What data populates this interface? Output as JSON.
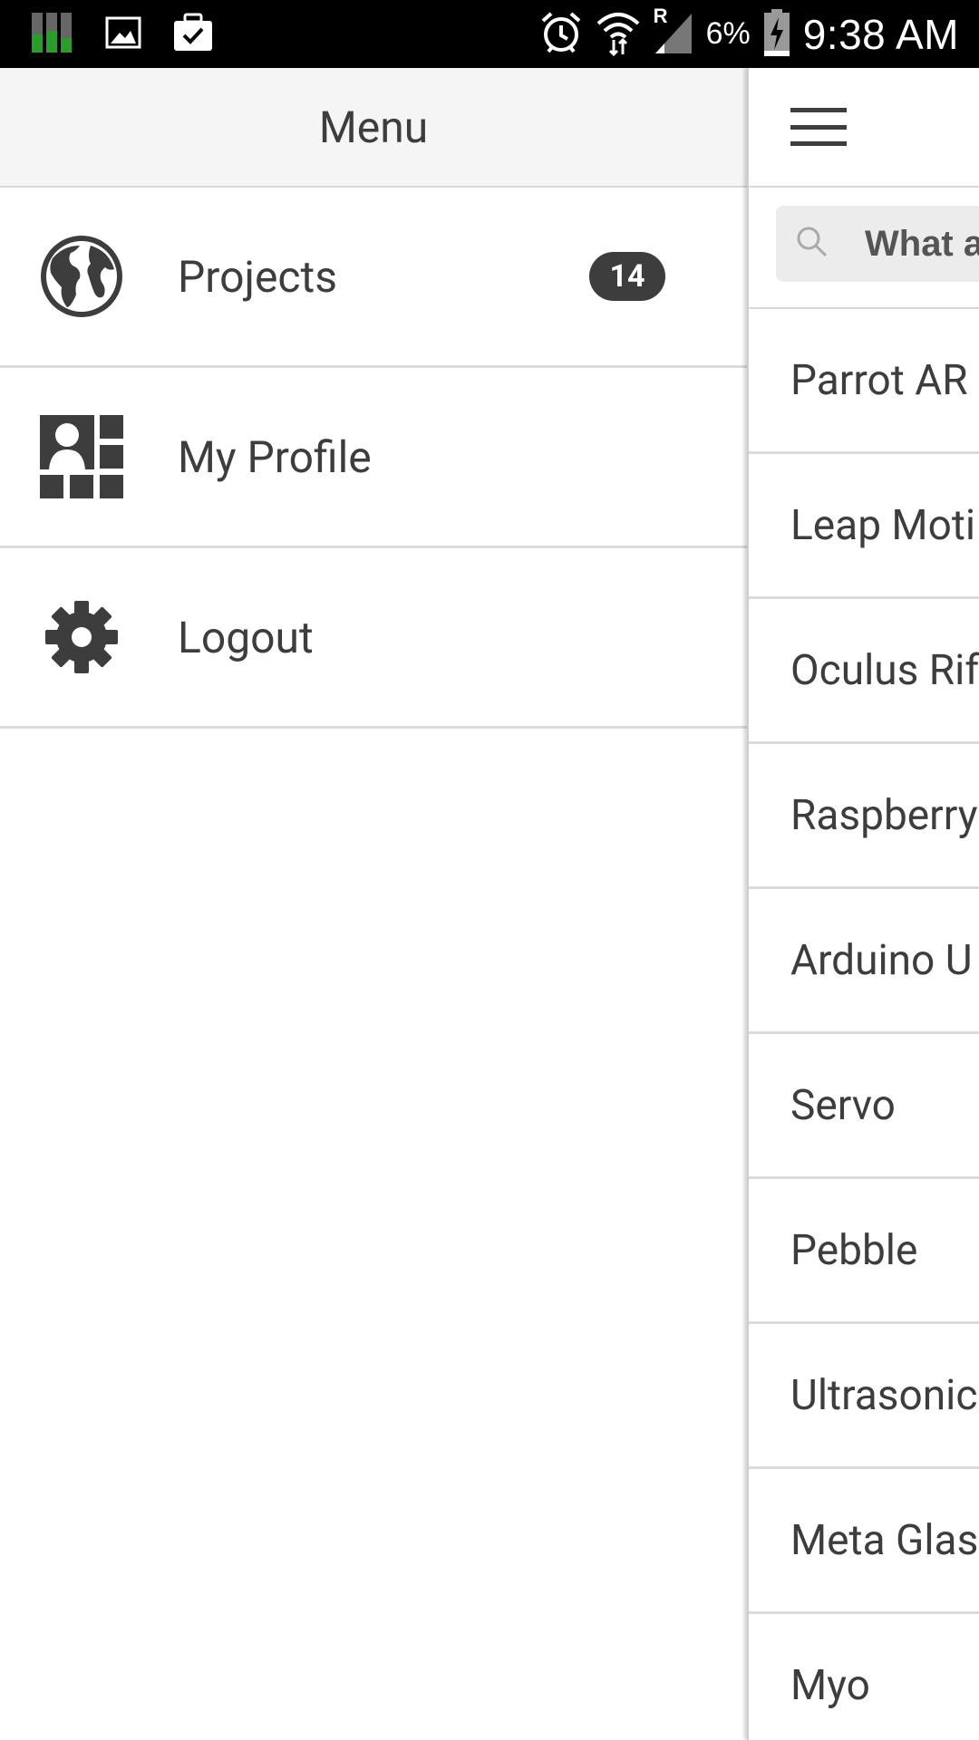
{
  "status_bar": {
    "battery_percent": "6%",
    "time": "9:38 AM",
    "signal_label": "R",
    "icons": [
      "signal-bars-icon",
      "image-icon",
      "briefcase-check-icon",
      "alarm-icon",
      "wifi-icon",
      "cell-signal-icon",
      "battery-charging-icon"
    ]
  },
  "drawer": {
    "title": "Menu",
    "items": [
      {
        "label": "Projects",
        "icon": "globe-icon",
        "badge": "14"
      },
      {
        "label": "My Profile",
        "icon": "profile-grid-icon"
      },
      {
        "label": "Logout",
        "icon": "gear-icon"
      }
    ]
  },
  "main": {
    "search": {
      "placeholder": "What a"
    },
    "items": [
      {
        "label": "Parrot AR"
      },
      {
        "label": "Leap Moti"
      },
      {
        "label": "Oculus Rif"
      },
      {
        "label": "Raspberry"
      },
      {
        "label": "Arduino U"
      },
      {
        "label": "Servo"
      },
      {
        "label": "Pebble"
      },
      {
        "label": "Ultrasonic"
      },
      {
        "label": "Meta Glas"
      },
      {
        "label": "Myo"
      }
    ]
  },
  "colors": {
    "text": "#3d3d3d",
    "badge": "#3d3d3d",
    "status_bar": "#000000",
    "header_bg": "#f5f5f5"
  }
}
